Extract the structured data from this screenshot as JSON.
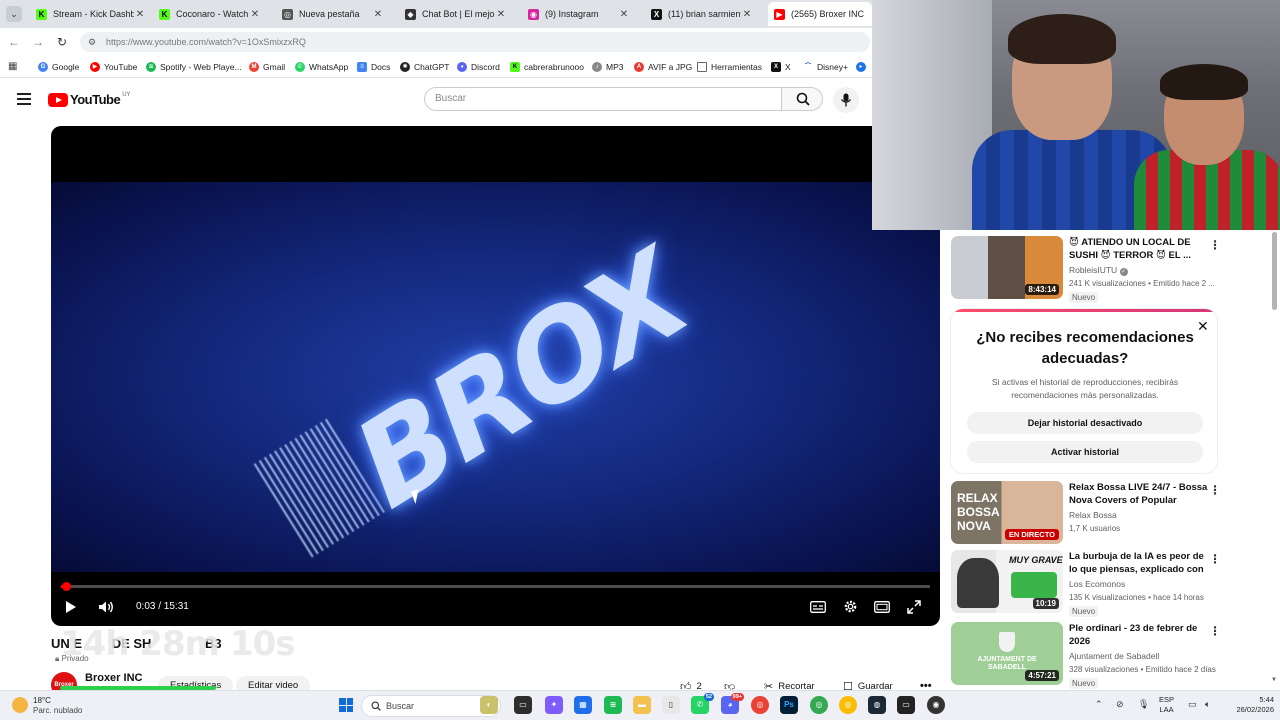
{
  "browser": {
    "tabs": [
      {
        "title": "Stream - Kick Dashbo",
        "icon": "kick-icon",
        "color": "#53fc18"
      },
      {
        "title": "Coconaro - Watch cli",
        "icon": "kick-icon",
        "color": "#53fc18"
      },
      {
        "title": "Nueva pestaña",
        "icon": "chrome-icon",
        "color": "#555555"
      },
      {
        "title": "Chat Bot | El mejor s",
        "icon": "chatbot-icon",
        "color": "#333333"
      },
      {
        "title": "(9) Instagram",
        "icon": "instagram-icon",
        "color": "#d6249f"
      },
      {
        "title": "(11) brian sarmiento",
        "icon": "x-icon",
        "color": "#111111"
      },
      {
        "title": "(2565) Broxer INC - Y",
        "icon": "youtube-icon",
        "color": "#ff0000"
      }
    ],
    "url": "https://www.youtube.com/watch?v=1OxSmixzxRQ",
    "bookmarks": [
      {
        "label": "Google",
        "color": "#4285f4"
      },
      {
        "label": "YouTube",
        "color": "#ff0000"
      },
      {
        "label": "Spotify - Web Playe...",
        "color": "#1db954"
      },
      {
        "label": "Gmail",
        "color": "#ea4335"
      },
      {
        "label": "WhatsApp",
        "color": "#25d366"
      },
      {
        "label": "Docs",
        "color": "#4285f4"
      },
      {
        "label": "ChatGPT",
        "color": "#222222"
      },
      {
        "label": "Discord",
        "color": "#5865f2"
      },
      {
        "label": "cabrerabrunooo",
        "color": "#53fc18"
      },
      {
        "label": "MP3",
        "color": "#888888"
      },
      {
        "label": "AVIF a JPG",
        "color": "#e53935"
      },
      {
        "label": "Herramientas",
        "color": "#777777"
      },
      {
        "label": "X",
        "color": "#111111"
      },
      {
        "label": "Disney+",
        "color": "#0b3d91"
      }
    ]
  },
  "youtube": {
    "logo_text": "YouTube",
    "country_code": "UY",
    "search_placeholder": "Buscar",
    "player": {
      "current_time": "0:03",
      "duration": "15:31",
      "time_display": "0:03 / 15:31",
      "progress": 0.003,
      "brand_text": "BROX"
    },
    "timer_overlay": "14h 28m 10s",
    "video_title": "UN E",
    "video_title_rest": "DE SH",
    "video_title_end": "B3",
    "privacy": "Privado",
    "channel": {
      "name": "Broxer INC",
      "avatar_text": "Broxer"
    },
    "owner_buttons": [
      "Estadísticas",
      "Editar video"
    ],
    "actions": {
      "likes": "2",
      "clip": "Recortar",
      "save": "Guardar"
    }
  },
  "sidebar": {
    "recommendations": [
      {
        "title": "😈 ATIENDO UN LOCAL DE SUSHI 😈 TERROR 😈 EL ...",
        "channel": "RobleisIUTU",
        "meta": "241 K visualizaciones • Emitido hace 2 ...",
        "badge": "Nuevo",
        "duration": "8:43:14",
        "live": false
      }
    ],
    "no_history": {
      "title": "¿No recibes recomendaciones adecuadas?",
      "text": "Si activas el historial de reproducciones, recibirás recomendaciones más personalizadas.",
      "keep_off": "Dejar historial desactivado",
      "turn_on": "Activar historial"
    },
    "more_recommendations": [
      {
        "title": "Relax Bossa LIVE 24/7 - Bossa Nova Covers of Popular Songs...",
        "channel": "Relax Bossa",
        "meta": "1,7 K usuarios",
        "badge": "",
        "duration": "EN DIRECTO",
        "live": true,
        "thumb_text": "RELAX BOSSA NOVA"
      },
      {
        "title": "La burbuja de la IA es peor de lo que piensas, explicado con ...",
        "channel": "Los Ecomonos",
        "meta": "135 K visualizaciones • hace 14 horas",
        "badge": "Nuevo",
        "duration": "10:19",
        "live": false,
        "thumb_text": "MUY GRAVE"
      },
      {
        "title": "Ple ordinari - 23 de febrer de 2026",
        "channel": "Ajuntament de Sabadell",
        "meta": "328 visualizaciones • Emitido hace 2 días",
        "badge": "Nuevo",
        "duration": "4:57:21",
        "live": false,
        "thumb_text": "AJUNTAMENT DE SABADELL"
      }
    ]
  },
  "taskbar": {
    "temperature": "18°C",
    "weather": "Parc. nublado",
    "search_placeholder": "Buscar",
    "language": "ESP",
    "layout": "LAA",
    "time": "5:44",
    "date": "26/02/2026",
    "whatsapp_badge": "52",
    "discord_badge": "99+"
  }
}
